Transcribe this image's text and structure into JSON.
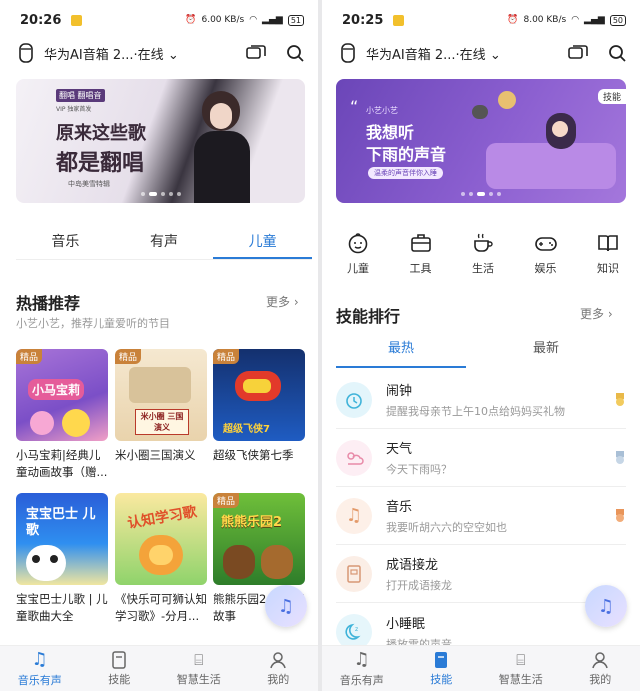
{
  "left": {
    "status": {
      "time": "20:26",
      "speed": "6.00 KB/s",
      "battery": "51"
    },
    "device_title": "华为AI音箱 2...",
    "device_status": "·在线",
    "banner": {
      "badge": "翻唱 翻唱音",
      "tag": "VIP 独家首发",
      "line1": "原来这些歌",
      "line2": "都是翻唱",
      "caption": "中岛美雪特辑"
    },
    "tabs": [
      "音乐",
      "有声",
      "儿童"
    ],
    "section": {
      "title": "热播推荐",
      "more": "更多",
      "subtitle": "小艺小艺，推荐儿童爱听的节目"
    },
    "cards": [
      {
        "tag": "精品",
        "title": "小马宝莉|经典儿童动画故事（赠...",
        "cover_text": "小马宝莉"
      },
      {
        "tag": "精品",
        "title": "米小圈三国演义",
        "cover_text": "米小圈 三国演义"
      },
      {
        "tag": "精品",
        "title": "超级飞侠第七季",
        "cover_text": "超级飞侠7"
      },
      {
        "tag": "",
        "title": "宝宝巴士儿歌 | 儿童歌曲大全",
        "cover_text": "宝宝巴士 儿歌"
      },
      {
        "tag": "",
        "title": "《快乐可可狮认知学习歌》-分月...",
        "cover_text": "认知学习歌"
      },
      {
        "tag": "精品",
        "title": "熊熊乐园2 权有声故事",
        "cover_text": "熊熊乐园2"
      }
    ],
    "nav": [
      "音乐有声",
      "技能",
      "智慧生活",
      "我的"
    ]
  },
  "right": {
    "status": {
      "time": "20:25",
      "speed": "8.00 KB/s",
      "battery": "50"
    },
    "device_title": "华为AI音箱 2...",
    "device_status": "·在线",
    "banner": {
      "corner": "技能",
      "small": "小艺小艺",
      "line1": "我想听",
      "line2": "下雨的声音",
      "caption": "温柔的声音伴你入睡"
    },
    "categories": [
      "儿童",
      "工具",
      "生活",
      "娱乐",
      "知识"
    ],
    "section": {
      "title": "技能排行",
      "more": "更多"
    },
    "rank_tabs": [
      "最热",
      "最新"
    ],
    "skills": [
      {
        "name": "闹钟",
        "desc": "提醒我母亲节上午10点给妈妈买礼物",
        "bg": "#e3f5fb",
        "color": "#3fb3d9",
        "medal": "#e9b949"
      },
      {
        "name": "天气",
        "desc": "今天下雨吗？",
        "bg": "#fdeef4",
        "color": "#e88aa8",
        "medal": "#a9bfd6"
      },
      {
        "name": "音乐",
        "desc": "我要听胡六六的空空如也",
        "bg": "#fdf0e8",
        "color": "#e39a6a",
        "medal": "#e9955a"
      },
      {
        "name": "成语接龙",
        "desc": "打开成语接龙",
        "bg": "#fbeee6",
        "color": "#d89775",
        "medal": ""
      },
      {
        "name": "小睡眠",
        "desc": "播放雪的声音",
        "bg": "#e6f6fb",
        "color": "#3fb3d9",
        "medal": ""
      }
    ],
    "nav": [
      "音乐有声",
      "技能",
      "智慧生活",
      "我的"
    ]
  },
  "colors": {
    "accent": "#2a7bd6",
    "tag": "#c9823a"
  }
}
